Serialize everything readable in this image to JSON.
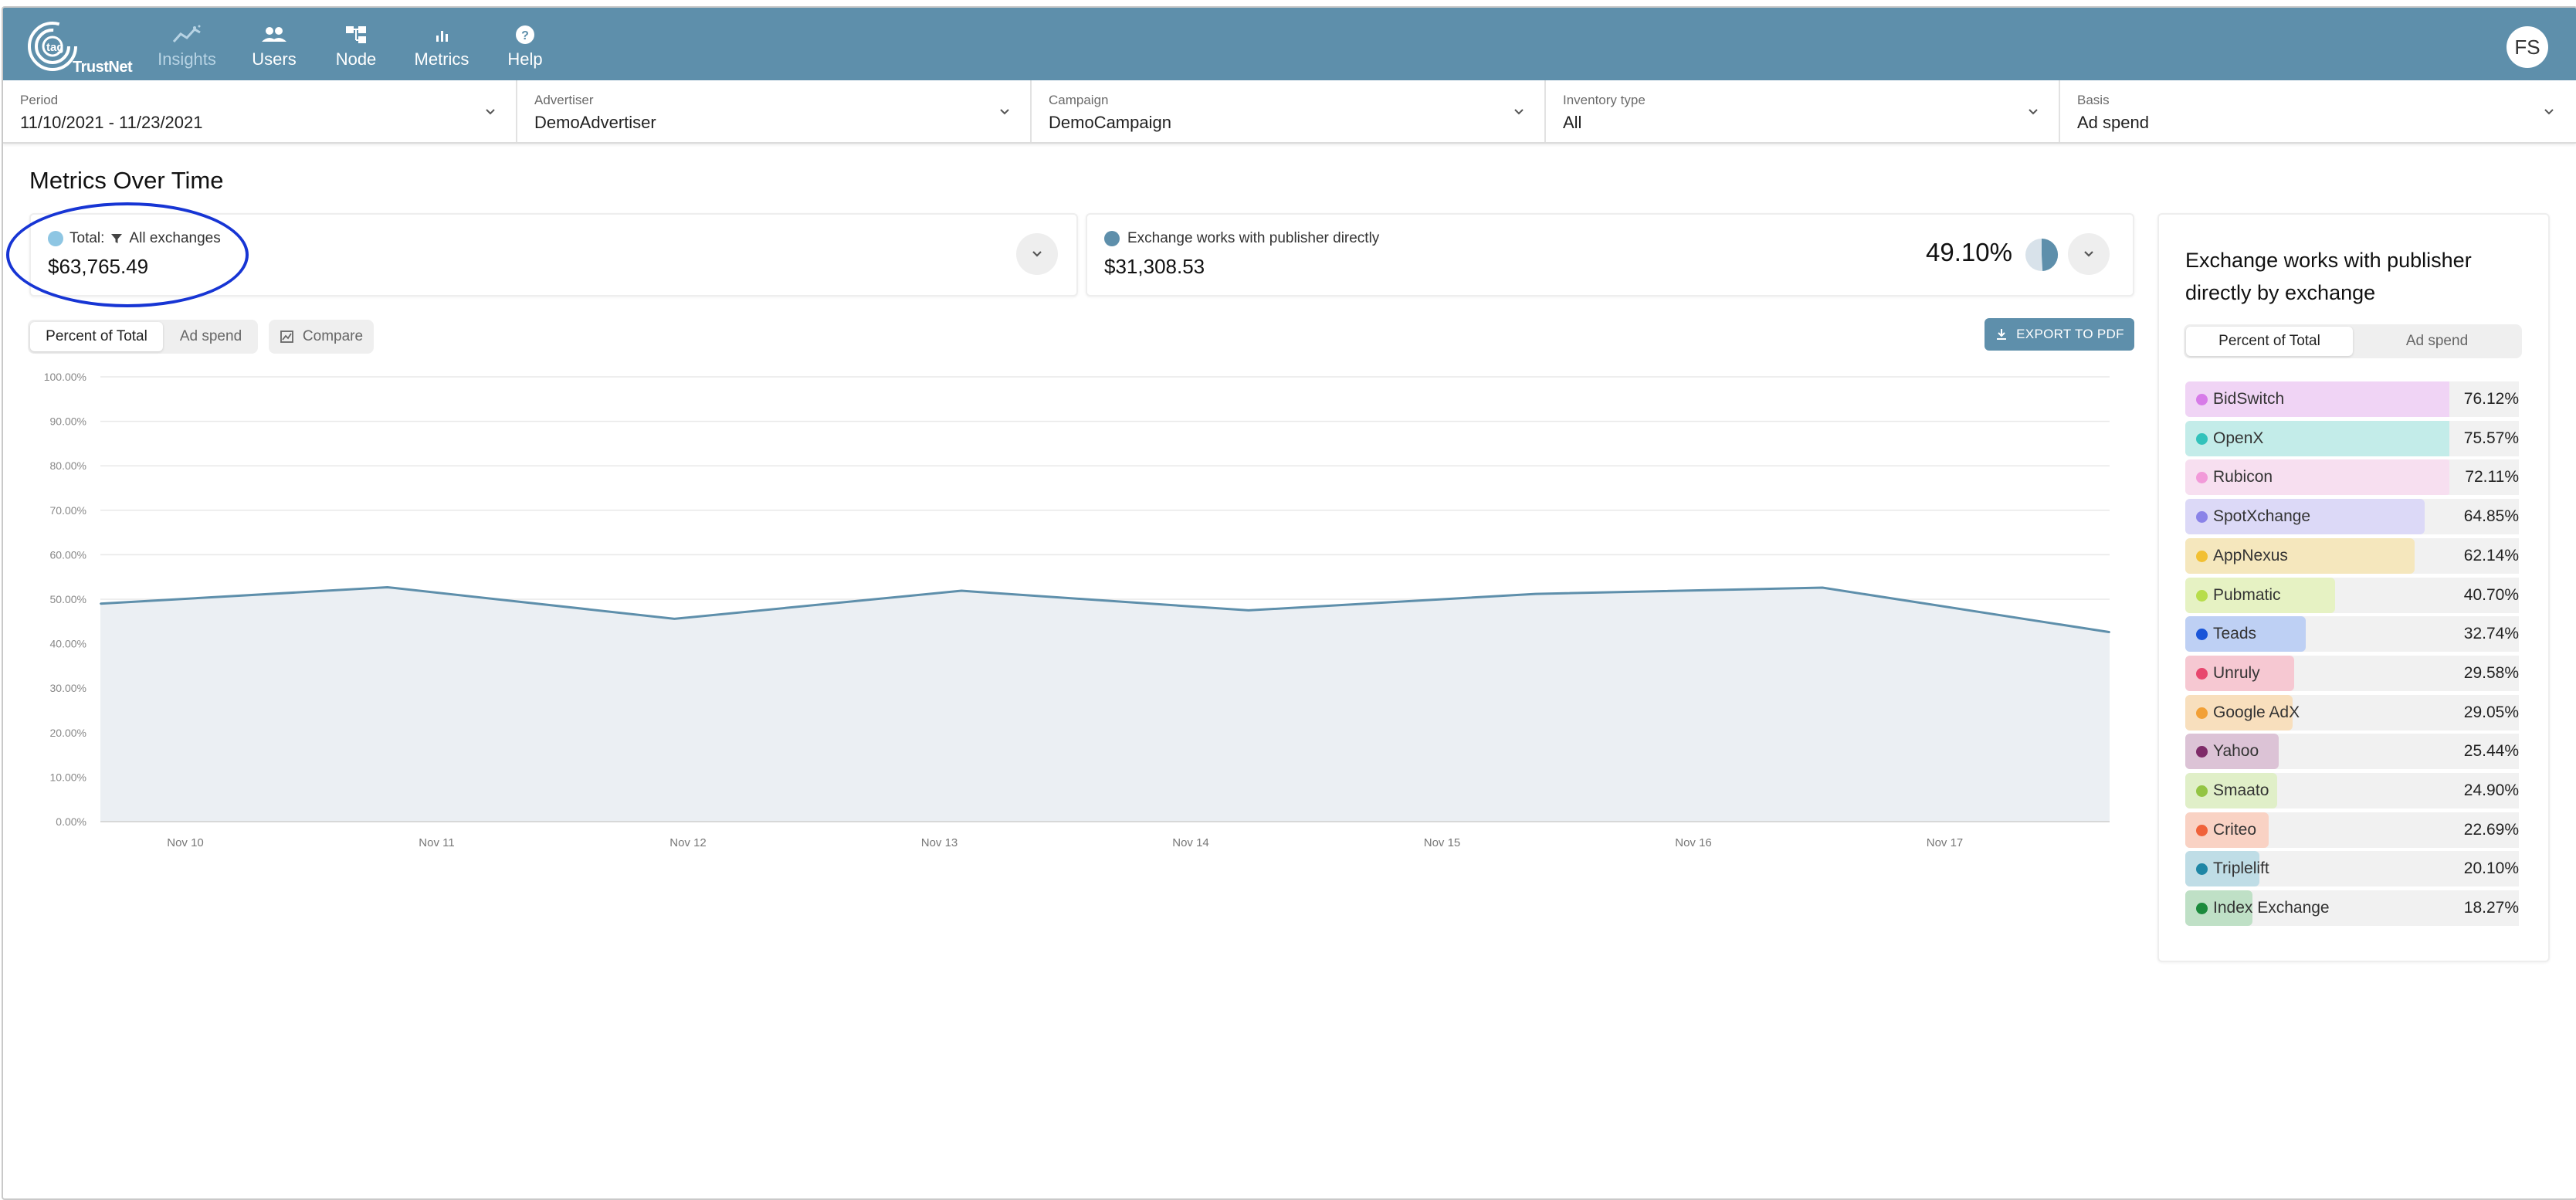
{
  "app": {
    "logo_text": "TrustNet",
    "logo_mark": "tag"
  },
  "nav": {
    "items": [
      {
        "label": "Insights",
        "icon": "insights-icon",
        "active": true
      },
      {
        "label": "Users",
        "icon": "users-icon",
        "active": false
      },
      {
        "label": "Node",
        "icon": "node-icon",
        "active": false
      },
      {
        "label": "Metrics",
        "icon": "metrics-icon",
        "active": false
      },
      {
        "label": "Help",
        "icon": "help-icon",
        "active": false
      }
    ],
    "avatar": "FS"
  },
  "filters": [
    {
      "label": "Period",
      "value": "11/10/2021 - 11/23/2021"
    },
    {
      "label": "Advertiser",
      "value": "DemoAdvertiser"
    },
    {
      "label": "Campaign",
      "value": "DemoCampaign"
    },
    {
      "label": "Inventory type",
      "value": "All"
    },
    {
      "label": "Basis",
      "value": "Ad spend"
    }
  ],
  "page": {
    "title": "Metrics Over Time"
  },
  "total_card": {
    "label": "Total:",
    "filter_label": "All exchanges",
    "value": "$63,765.49",
    "dot_color": "#8ec6e3"
  },
  "metric_card": {
    "label": "Exchange works with publisher directly",
    "value": "$31,308.53",
    "percent": "49.10%",
    "percent_value": 49.1,
    "dot_color": "#5e8fab"
  },
  "chart_controls": {
    "tabs": [
      "Percent of Total",
      "Ad spend"
    ],
    "selected": "Percent of Total",
    "compare_label": "Compare",
    "export_label": "EXPORT TO PDF"
  },
  "chart_data": {
    "type": "area",
    "x": [
      "Nov 10",
      "Nov 11",
      "Nov 12",
      "Nov 13",
      "Nov 14",
      "Nov 15",
      "Nov 16",
      "Nov 17"
    ],
    "series": [
      {
        "values": [
          49.0,
          52.7,
          45.6,
          51.9,
          47.5,
          51.2,
          52.6,
          42.6
        ],
        "color": "#5e8fab",
        "fill": "#ebeff3"
      }
    ],
    "y_ticks": [
      "0.00%",
      "10.00%",
      "20.00%",
      "30.00%",
      "40.00%",
      "50.00%",
      "60.00%",
      "70.00%",
      "80.00%",
      "90.00%",
      "100.00%"
    ],
    "ylim": [
      0,
      100
    ],
    "grid": true
  },
  "side_panel": {
    "title": "Exchange works with publisher directly by exchange",
    "tabs": [
      "Percent of Total",
      "Ad spend"
    ],
    "selected": "Percent of Total",
    "exchanges": [
      {
        "name": "BidSwitch",
        "percent": "76.12%",
        "value": 76.12,
        "color": "#d77be8",
        "bar": "#f0d4f5"
      },
      {
        "name": "OpenX",
        "percent": "75.57%",
        "value": 75.57,
        "color": "#32c2bb",
        "bar": "#c3ece9"
      },
      {
        "name": "Rubicon",
        "percent": "72.11%",
        "value": 72.11,
        "color": "#f29ad9",
        "bar": "#f7dff0"
      },
      {
        "name": "SpotXchange",
        "percent": "64.85%",
        "value": 64.85,
        "color": "#8a83e8",
        "bar": "#dcd9f7"
      },
      {
        "name": "AppNexus",
        "percent": "62.14%",
        "value": 62.14,
        "color": "#f2c032",
        "bar": "#f5e7bd"
      },
      {
        "name": "Pubmatic",
        "percent": "40.70%",
        "value": 40.7,
        "color": "#b7dd4a",
        "bar": "#e6f2c3"
      },
      {
        "name": "Teads",
        "percent": "32.74%",
        "value": 32.74,
        "color": "#1a55d8",
        "bar": "#bed0f4"
      },
      {
        "name": "Unruly",
        "percent": "29.58%",
        "value": 29.58,
        "color": "#e8476e",
        "bar": "#f6c8d2"
      },
      {
        "name": "Google AdX",
        "percent": "29.05%",
        "value": 29.05,
        "color": "#f2a036",
        "bar": "#f8dfbd"
      },
      {
        "name": "Yahoo",
        "percent": "25.44%",
        "value": 25.44,
        "color": "#7e2b68",
        "bar": "#dcc3d6"
      },
      {
        "name": "Smaato",
        "percent": "24.90%",
        "value": 24.9,
        "color": "#93c443",
        "bar": "#e0efc8"
      },
      {
        "name": "Criteo",
        "percent": "22.69%",
        "value": 22.69,
        "color": "#f0623a",
        "bar": "#f9d2c4"
      },
      {
        "name": "Triplelift",
        "percent": "20.10%",
        "value": 20.1,
        "color": "#1e86a5",
        "bar": "#bfdde6"
      },
      {
        "name": "Index Exchange",
        "percent": "18.27%",
        "value": 18.27,
        "color": "#1b8a3c",
        "bar": "#bfe0c6"
      }
    ]
  }
}
